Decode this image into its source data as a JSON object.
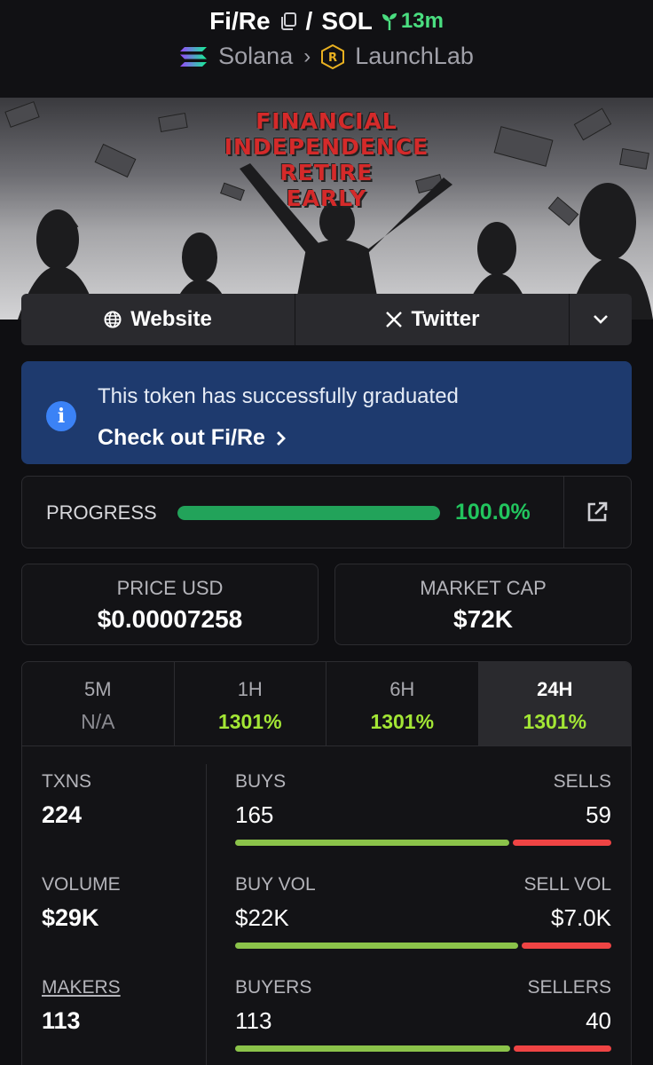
{
  "header": {
    "pair_base": "Fi/Re",
    "separator": "/",
    "pair_quote": "SOL",
    "age": "13m",
    "chain": "Solana",
    "platform": "LaunchLab",
    "icons": [
      "copy-icon",
      "sprout-icon",
      "solana-icon",
      "chevron-right-icon",
      "launchlab-icon"
    ]
  },
  "banner": {
    "lines": [
      "FINANCIAL",
      "INDEPENDENCE",
      "RETIRE",
      "EARLY"
    ]
  },
  "links": {
    "website": "Website",
    "twitter": "Twitter",
    "website_icon": "globe-icon",
    "twitter_icon": "x-icon",
    "more_icon": "chevron-down-icon"
  },
  "notice": {
    "message": "This token has successfully graduated",
    "cta": "Check out Fi/Re",
    "icon": "info-icon",
    "accent": "#1e3a6e"
  },
  "progress": {
    "label": "PROGRESS",
    "value_text": "100.0%",
    "fraction": 1.0,
    "color": "#22a35a"
  },
  "price": {
    "label": "PRICE USD",
    "value": "$0.00007258"
  },
  "market_cap": {
    "label": "MARKET CAP",
    "value": "$72K"
  },
  "timeframes": [
    {
      "name": "5M",
      "value": "N/A",
      "active": false
    },
    {
      "name": "1H",
      "value": "1301%",
      "active": false
    },
    {
      "name": "6H",
      "value": "1301%",
      "active": false
    },
    {
      "name": "24H",
      "value": "1301%",
      "active": true
    }
  ],
  "metrics": {
    "txns": {
      "label": "TXNS",
      "value": "224"
    },
    "buys": {
      "label": "BUYS",
      "value": "165"
    },
    "sells": {
      "label": "SELLS",
      "value": "59"
    },
    "volume": {
      "label": "VOLUME",
      "value": "$29K"
    },
    "buy_vol": {
      "label": "BUY VOL",
      "value": "$22K"
    },
    "sell_vol": {
      "label": "SELL VOL",
      "value": "$7.0K"
    },
    "makers": {
      "label": "MAKERS",
      "value": "113"
    },
    "buyers": {
      "label": "BUYERS",
      "value": "113"
    },
    "sellers": {
      "label": "SELLERS",
      "value": "40"
    },
    "buy_color": "#8bc34a",
    "sell_color": "#ef4444"
  }
}
